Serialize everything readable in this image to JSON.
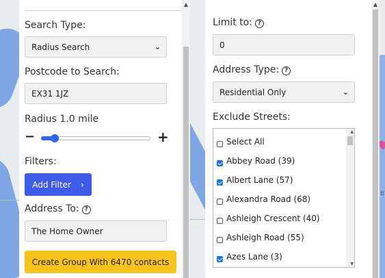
{
  "left": {
    "search_type_label": "Search Type:",
    "search_type_value": "Radius Search",
    "postcode_label": "Postcode to Search:",
    "postcode_value": "EX31 1JZ",
    "radius_label": "Radius 1.0 mile",
    "radius_value": 0.1,
    "filters_label": "Filters:",
    "add_filter_label": "Add Filter",
    "address_to_label": "Address To:",
    "address_to_value": "The Home Owner",
    "create_group_label": "Create Group With 6470 contacts"
  },
  "right": {
    "limit_label": "Limit to:",
    "limit_value": "0",
    "address_type_label": "Address Type:",
    "address_type_value": "Residential Only",
    "exclude_streets_label": "Exclude Streets:",
    "streets": [
      {
        "label": "Select All",
        "checked": false
      },
      {
        "label": "Abbey Road (39)",
        "checked": true
      },
      {
        "label": "Albert Lane (57)",
        "checked": true
      },
      {
        "label": "Alexandra Road (68)",
        "checked": false
      },
      {
        "label": "Ashleigh Crescent (40)",
        "checked": false
      },
      {
        "label": "Ashleigh Road (55)",
        "checked": false
      },
      {
        "label": "Azes Lane (3)",
        "checked": true
      }
    ]
  },
  "icons": {
    "help": "question-circle-icon",
    "chevron": "chevron-down-icon",
    "add_filter_arrow": "chevron-right-icon"
  },
  "colors": {
    "primary_button": "#3f5bea",
    "accent_button": "#f9c31e",
    "checkbox_checked": "#1a73e8"
  },
  "map": {
    "side_label_1": "B"
  }
}
